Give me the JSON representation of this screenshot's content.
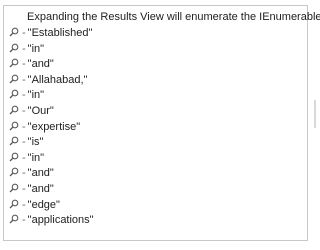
{
  "results_view": {
    "header": "Expanding the Results View will enumerate the IEnumerable",
    "separator": "-",
    "items": [
      {
        "icon": "magnifier-icon",
        "value": "\"Established\""
      },
      {
        "icon": "magnifier-icon",
        "value": "\"in\""
      },
      {
        "icon": "magnifier-icon",
        "value": "\"and\""
      },
      {
        "icon": "magnifier-icon",
        "value": "\"Allahabad,\""
      },
      {
        "icon": "magnifier-icon",
        "value": "\"in\""
      },
      {
        "icon": "magnifier-icon",
        "value": "\"Our\""
      },
      {
        "icon": "magnifier-icon",
        "value": "\"expertise\""
      },
      {
        "icon": "magnifier-icon",
        "value": "\"is\""
      },
      {
        "icon": "magnifier-icon",
        "value": "\"in\""
      },
      {
        "icon": "magnifier-icon",
        "value": "\"and\""
      },
      {
        "icon": "magnifier-icon",
        "value": "\"and\""
      },
      {
        "icon": "magnifier-icon",
        "value": "\"edge\""
      },
      {
        "icon": "magnifier-icon",
        "value": "\"applications\""
      }
    ]
  },
  "colors": {
    "text": "#1e1e1e",
    "separator": "#6a6a6a",
    "border": "#c8c8c8",
    "icon": "#5a5a5a"
  }
}
